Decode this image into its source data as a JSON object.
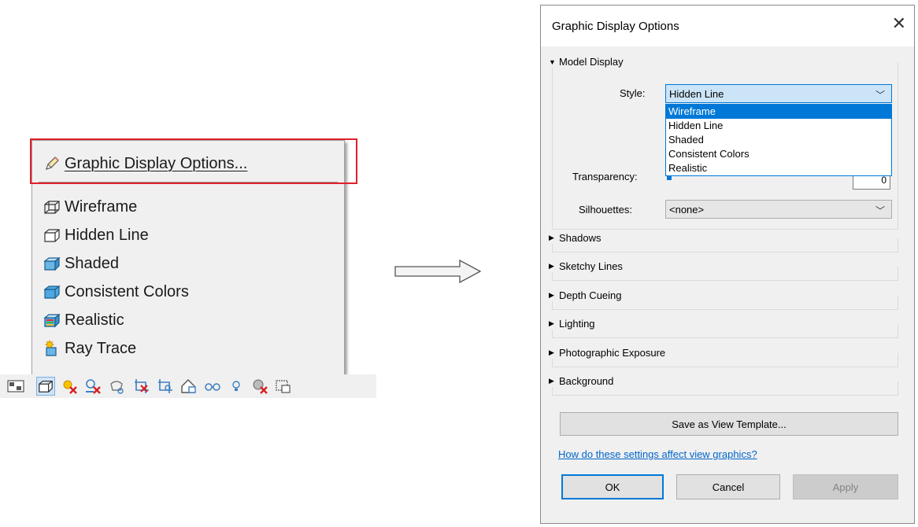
{
  "context_menu": {
    "header_item": "Graphic Display Options...",
    "items": [
      {
        "label": "Wireframe",
        "icon": "wireframe-cube-icon"
      },
      {
        "label": "Hidden Line",
        "icon": "hidden-line-cube-icon"
      },
      {
        "label": "Shaded",
        "icon": "shaded-cube-icon"
      },
      {
        "label": "Consistent Colors",
        "icon": "consistent-colors-cube-icon"
      },
      {
        "label": "Realistic",
        "icon": "realistic-cube-icon"
      },
      {
        "label": "Ray Trace",
        "icon": "ray-trace-icon"
      }
    ]
  },
  "dialog": {
    "title": "Graphic Display Options",
    "close_glyph": "✕",
    "model_display": {
      "label": "Model Display",
      "style_label": "Style:",
      "style_value": "Hidden Line",
      "style_options": [
        "Wireframe",
        "Hidden Line",
        "Shaded",
        "Consistent Colors",
        "Realistic"
      ],
      "style_highlighted": "Wireframe",
      "transparency_label": "Transparency:",
      "transparency_value": "0",
      "silhouettes_label": "Silhouettes:",
      "silhouettes_value": "<none>"
    },
    "collapsed_sections": [
      "Shadows",
      "Sketchy Lines",
      "Depth Cueing",
      "Lighting",
      "Photographic Exposure",
      "Background"
    ],
    "save_template_button": "Save as View Template...",
    "help_link": "How do these settings affect view graphics?",
    "ok_button": "OK",
    "cancel_button": "Cancel",
    "apply_button": "Apply"
  },
  "colors": {
    "highlight_border": "#e0202a",
    "accent": "#0078d7",
    "link": "#0066cc"
  }
}
